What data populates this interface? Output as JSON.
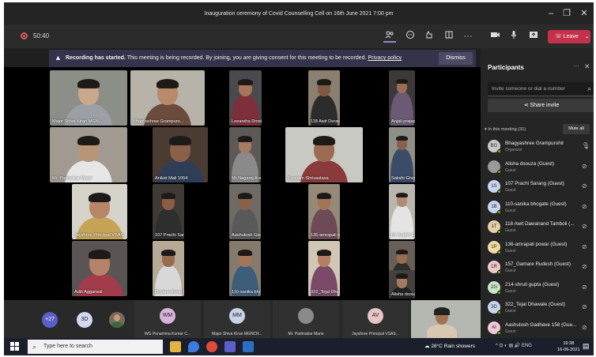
{
  "window": {
    "title": "Inauguration ceremony of Covid Counselling Cell on 16th June 2021 7:00 pm",
    "minimize": "–",
    "maximize": "❐",
    "close": "✕"
  },
  "toolbar": {
    "timer": "50:40",
    "leave_label": "Leave",
    "icons": [
      "participants-icon",
      "chat-icon",
      "reactions-icon",
      "rooms-icon",
      "more-icon",
      "camera-icon",
      "mic-icon",
      "share-icon"
    ]
  },
  "banner": {
    "bold": "Recording has started.",
    "text": "This meeting is being recorded. By joining, you are giving consent for this meeting to be recorded.",
    "link": "Privacy policy",
    "dismiss": "Dismiss"
  },
  "tiles": [
    {
      "name": "Major Shiva Kiran MGN...",
      "bg": "#8c8f88",
      "skin": "#c9a88c",
      "shirt": "#9aa0a6"
    },
    {
      "name": "Bhagyashree Grampuro...",
      "bg": "#b8b3a8",
      "skin": "#b8896a",
      "shirt": "#6a4b3c"
    },
    {
      "name": "Leeandra Dmello",
      "bg": "#4a4a4e",
      "skin": "#a8745a",
      "shirt": "#7e2f3c"
    },
    {
      "name": "118 Awit Deravano T...",
      "bg": "#8a7f70",
      "skin": "#7e5a45",
      "shirt": "#2c2c2c"
    },
    {
      "name": "Anjali prajapati",
      "bg": "#3c3a38",
      "skin": "#9a6d55",
      "shirt": "#6b5a74"
    },
    {
      "name": "Mr. Padmakar Mane",
      "bg": "#a09a91",
      "skin": "#b99578",
      "shirt": "#e6e6e6"
    },
    {
      "name": "Aniket Mali 1054",
      "bg": "#4a3b33",
      "skin": "#8a6048",
      "shirt": "#2f3e57"
    },
    {
      "name": "Mr Nagaraj Arabhavi",
      "bg": "#5c5956",
      "skin": "#a57c63",
      "shirt": "#8a8a8a"
    },
    {
      "name": "Poonam Shrivastava",
      "bg": "#c9c9c4",
      "skin": "#9d6a52",
      "shirt": "#8a3a3a"
    },
    {
      "name": "Sakshi Ghorpade",
      "bg": "#8e8f86",
      "skin": "#8a5f4a",
      "shirt": "#3b4c6b"
    },
    {
      "name": "Jayshree Principal VSAS...",
      "bg": "#d6d3ca",
      "skin": "#b78666",
      "shirt": "#c6a457"
    },
    {
      "name": "107 Prachi Sarang",
      "bg": "#3f3a35",
      "skin": "#8c5d45",
      "shirt": "#2e2e2e"
    },
    {
      "name": "Aashutosh Gadhave 1...",
      "bg": "#6e6a64",
      "skin": "#8a6048",
      "shirt": "#595959"
    },
    {
      "name": "136-amrapali powar",
      "bg": "#958a78",
      "skin": "#a37458",
      "shirt": "#6e4a57"
    },
    {
      "name": "Mr Sudhir Gedit",
      "bg": "#b9b6ad",
      "skin": "#b08a74",
      "shirt": "#e4e4e4"
    },
    {
      "name": "Aditi Aggarwal",
      "bg": "#5a5554",
      "skin": "#b5836a",
      "shirt": "#a23b4a"
    },
    {
      "name": "Dnyaneshwar Dhobale",
      "bg": "#b6a995",
      "skin": "#9a6a50",
      "shirt": "#d8d8d8"
    },
    {
      "name": "110-sanika bhogate",
      "bg": "#857b6d",
      "skin": "#a57558",
      "shirt": "#3e5d7a"
    },
    {
      "name": "322_Tejal Dhawale",
      "bg": "#d1c7b4",
      "skin": "#b28060",
      "shirt": "#7b4a68"
    },
    {
      "name": "214-shruti gupta",
      "bg": "#675f58",
      "skin": "#9c6c50",
      "shirt": "#2d2d2d"
    },
    {
      "name": "Alisha dsouza",
      "bg": "#44403d",
      "skin": "#a57a64",
      "shirt": "#222"
    }
  ],
  "strip": {
    "overflow_count": "+27",
    "badge_3d": "3D",
    "cards": [
      {
        "initials": "WM",
        "name": "WG Ponamma Kumar C...",
        "color": "#d8b4dc"
      },
      {
        "initials": "MM",
        "name": "Major Shiva Kiran MGNCR...",
        "color": "#c8d2e8"
      },
      {
        "initials": "",
        "name": "Mr. Padmakar Mane",
        "color": "#8a8a8a"
      },
      {
        "initials": "AV",
        "name": "Jayshree Principal VSAS...",
        "color": "#e8c4c4"
      }
    ]
  },
  "panel": {
    "title": "Participants",
    "more": "···",
    "close": "✕",
    "invite_placeholder": "Invite someone or dial a number",
    "share_invite": "Share invite",
    "in_meeting": "In this meeting (31)",
    "mute_all": "Mute all",
    "participants": [
      {
        "initials": "BG",
        "name": "Bhagyashree Grampurohit",
        "role": "Organizer",
        "color": "#c9c9c9"
      },
      {
        "initials": "",
        "name": "Alisha dsouza (Guest)",
        "role": "Guest",
        "color": "#9a9a9a"
      },
      {
        "initials": "1S",
        "name": "107 Prachi Sarang (Guest)",
        "role": "Guest",
        "color": "#c8d6ef"
      },
      {
        "initials": "1B",
        "name": "110-sanika bhogate (Guest)",
        "role": "Guest",
        "color": "#c8d6ef"
      },
      {
        "initials": "1T",
        "name": "118 Awit Dawanand Tamboli (...",
        "role": "Guest",
        "color": "#e6d0a6"
      },
      {
        "initials": "1P",
        "name": "136-amrapali powar (Guest)",
        "role": "Guest",
        "color": "#f0dba0"
      },
      {
        "initials": "1R",
        "name": "157_Gamare Rudesh (Guest)",
        "role": "Guest",
        "color": "#f0c8c8"
      },
      {
        "initials": "2G",
        "name": "214-shruti gupta (Guest)",
        "role": "Guest",
        "color": "#c8e6c8"
      },
      {
        "initials": "3D",
        "name": "322_Tejal Dhawale (Guest)",
        "role": "Guest",
        "color": "#c8d6ef"
      },
      {
        "initials": "AI",
        "name": "Aashutosh Gadhave 158 (Gue...",
        "role": "Guest",
        "color": "#f0c8d8"
      }
    ]
  },
  "taskbar": {
    "search_placeholder": "Type here to search",
    "weather": "28°C  Rain showers",
    "tray": "^ ⊡ ◐ ▤ 🔊 ENG",
    "time": "19:38",
    "date": "16-06-2021"
  }
}
